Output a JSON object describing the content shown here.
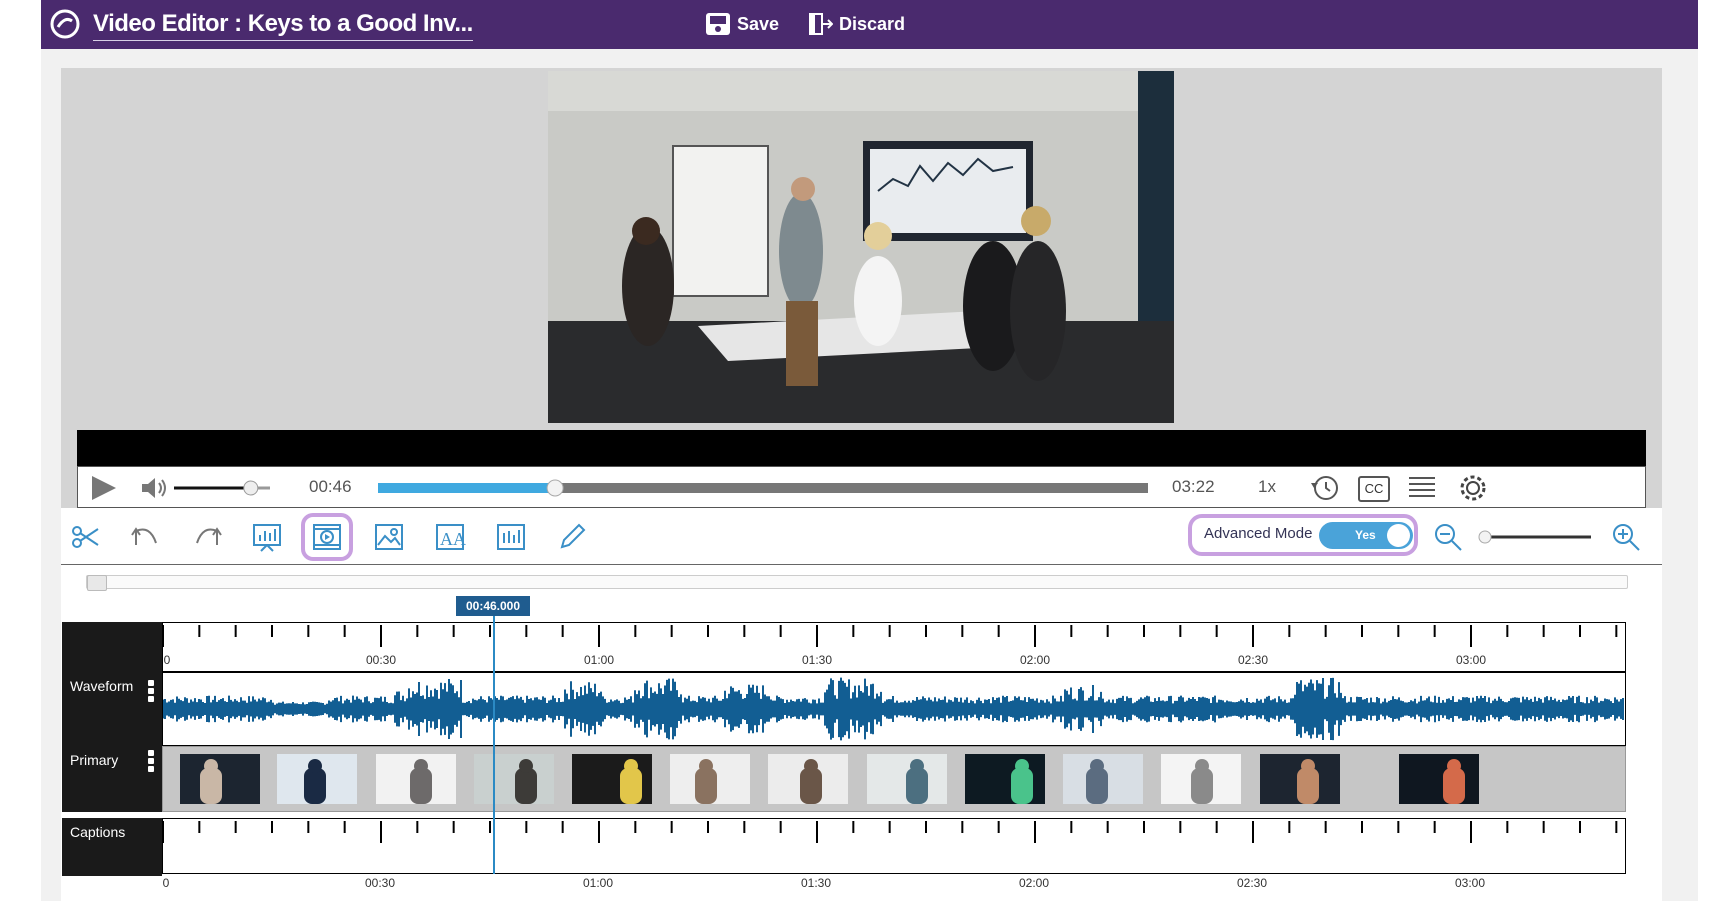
{
  "header": {
    "title": "Video Editor : Keys to a Good Inv...",
    "save_label": "Save",
    "discard_label": "Discard"
  },
  "player": {
    "current_time": "00:46",
    "duration": "03:22",
    "speed": "1x",
    "cc_label": "CC",
    "progress_fraction": 0.23,
    "volume_fraction": 0.8
  },
  "toolbar": {
    "advanced_mode_label": "Advanced Mode",
    "advanced_mode_value": "Yes",
    "zoom_fraction": 0.0
  },
  "timeline": {
    "playhead_time": "00:46.000",
    "ruler_labels": [
      "0",
      "00:30",
      "01:00",
      "01:30",
      "02:00",
      "02:30",
      "03:00"
    ],
    "tracks": {
      "waveform": "Waveform",
      "primary": "Primary",
      "captions": "Captions"
    }
  },
  "colors": {
    "header_bg": "#4a2a6e",
    "accent_blue": "#1f5c8f",
    "waveform": "#125e93",
    "highlight": "#c8a0e0"
  }
}
